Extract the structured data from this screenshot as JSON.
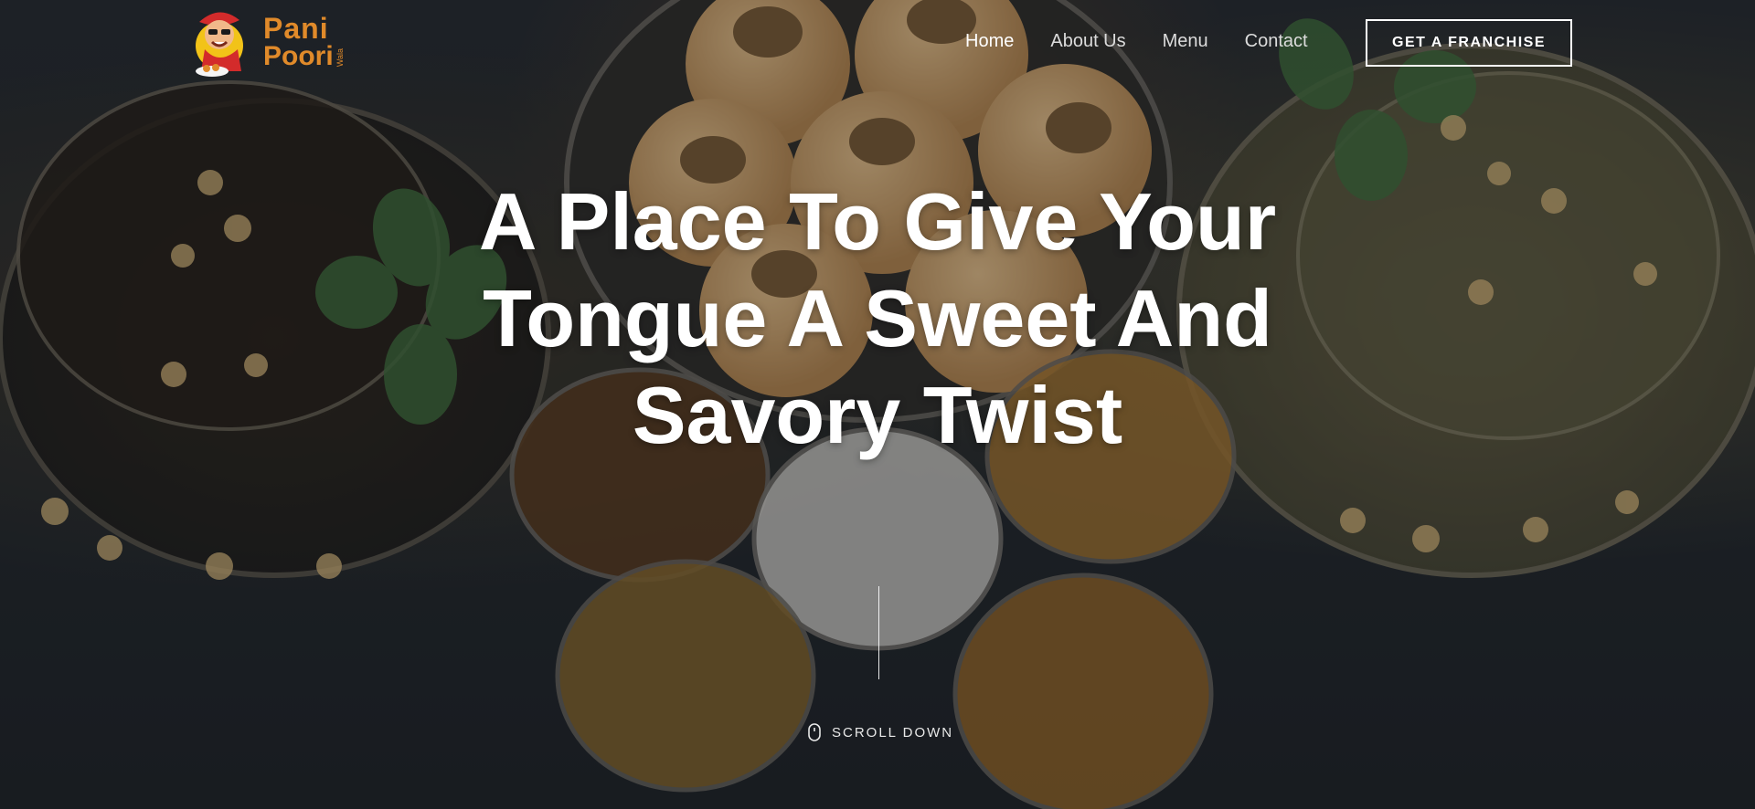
{
  "brand": {
    "line1": "Pani",
    "line2": "Poori",
    "tag": "Wala"
  },
  "nav": {
    "items": [
      {
        "label": "Home",
        "active": true
      },
      {
        "label": "About Us",
        "active": false
      },
      {
        "label": "Menu",
        "active": false
      },
      {
        "label": "Contact",
        "active": false
      }
    ],
    "cta": "GET A FRANCHISE"
  },
  "hero": {
    "headline_line1": "A Place To Give Your",
    "headline_line2": "Tongue A Sweet And",
    "headline_line3": "Savory Twist",
    "scroll_label": "SCROLL DOWN"
  },
  "colors": {
    "brand_orange": "#e08a2a",
    "text_white": "#ffffff",
    "background_dark": "#1f2428"
  },
  "icons": [
    "mouse-icon"
  ]
}
